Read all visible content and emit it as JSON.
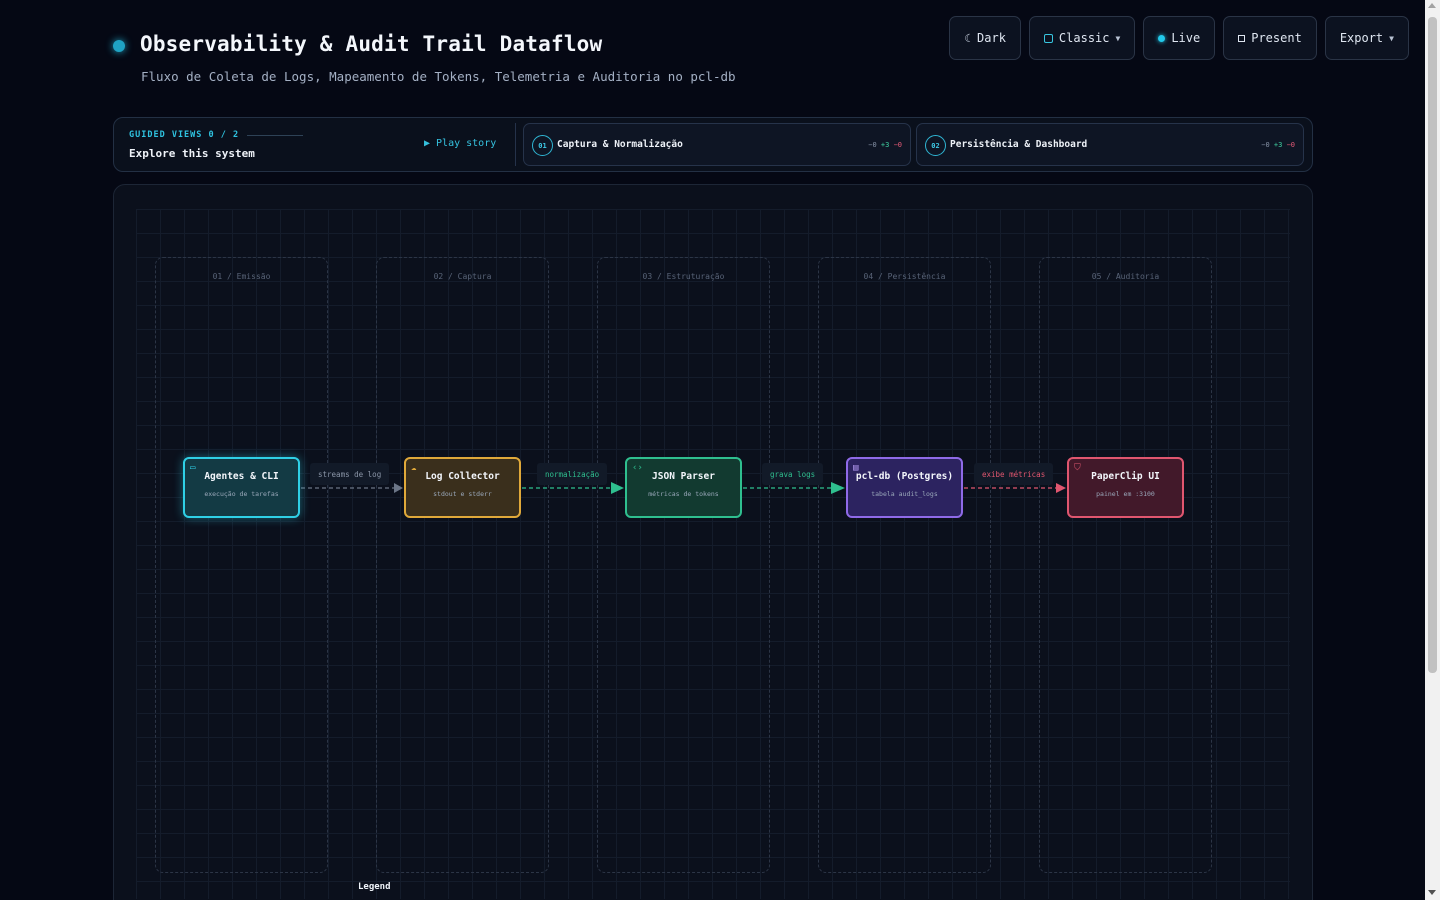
{
  "header": {
    "title": "Observability & Audit Trail Dataflow",
    "subtitle": "Fluxo de Coleta de Logs, Mapeamento de Tokens, Telemetria e Auditoria no pcl-db"
  },
  "toolbar": {
    "dark_label": "Dark",
    "classic_label": "Classic",
    "live_label": "Live",
    "present_label": "Present",
    "export_label": "Export"
  },
  "guided": {
    "label": "GUIDED VIEWS 0 / 2",
    "subtitle": "Explore this system",
    "play_label": "▶ Play story",
    "steps": [
      {
        "num": "01",
        "label": "Captura & Normalização",
        "d0": "−0",
        "d1": "+3",
        "d2": "−0"
      },
      {
        "num": "02",
        "label": "Persistência & Dashboard",
        "d0": "−0",
        "d1": "+3",
        "d2": "−0"
      }
    ]
  },
  "lanes": [
    {
      "label": "01 / Emissão"
    },
    {
      "label": "02 / Captura"
    },
    {
      "label": "03 / Estruturação"
    },
    {
      "label": "04 / Persistência"
    },
    {
      "label": "05 / Auditoria"
    }
  ],
  "nodes": [
    {
      "title": "Agentes & CLI",
      "sub": "execução de tarefas",
      "icon": "terminal-icon",
      "color": "#2fd0e6"
    },
    {
      "title": "Log Collector",
      "sub": "stdout e stderr",
      "icon": "cloud-icon",
      "color": "#e0a93a"
    },
    {
      "title": "JSON Parser",
      "sub": "métricas de tokens",
      "icon": "code-icon",
      "color": "#2fbf8f"
    },
    {
      "title": "pcl-db (Postgres)",
      "sub": "tabela audit_logs",
      "icon": "database-icon",
      "color": "#8f6ae8"
    },
    {
      "title": "PaperClip UI",
      "sub": "painel em :3100",
      "icon": "shield-icon",
      "color": "#e0566f"
    }
  ],
  "edges": [
    {
      "label": "streams de log",
      "color": "#8b96a8"
    },
    {
      "label": "normalização",
      "color": "#2fbf8f"
    },
    {
      "label": "grava logs",
      "color": "#2fbf8f"
    },
    {
      "label": "exibe métricas",
      "color": "#e0566f"
    }
  ],
  "legend": {
    "label": "Legend"
  }
}
